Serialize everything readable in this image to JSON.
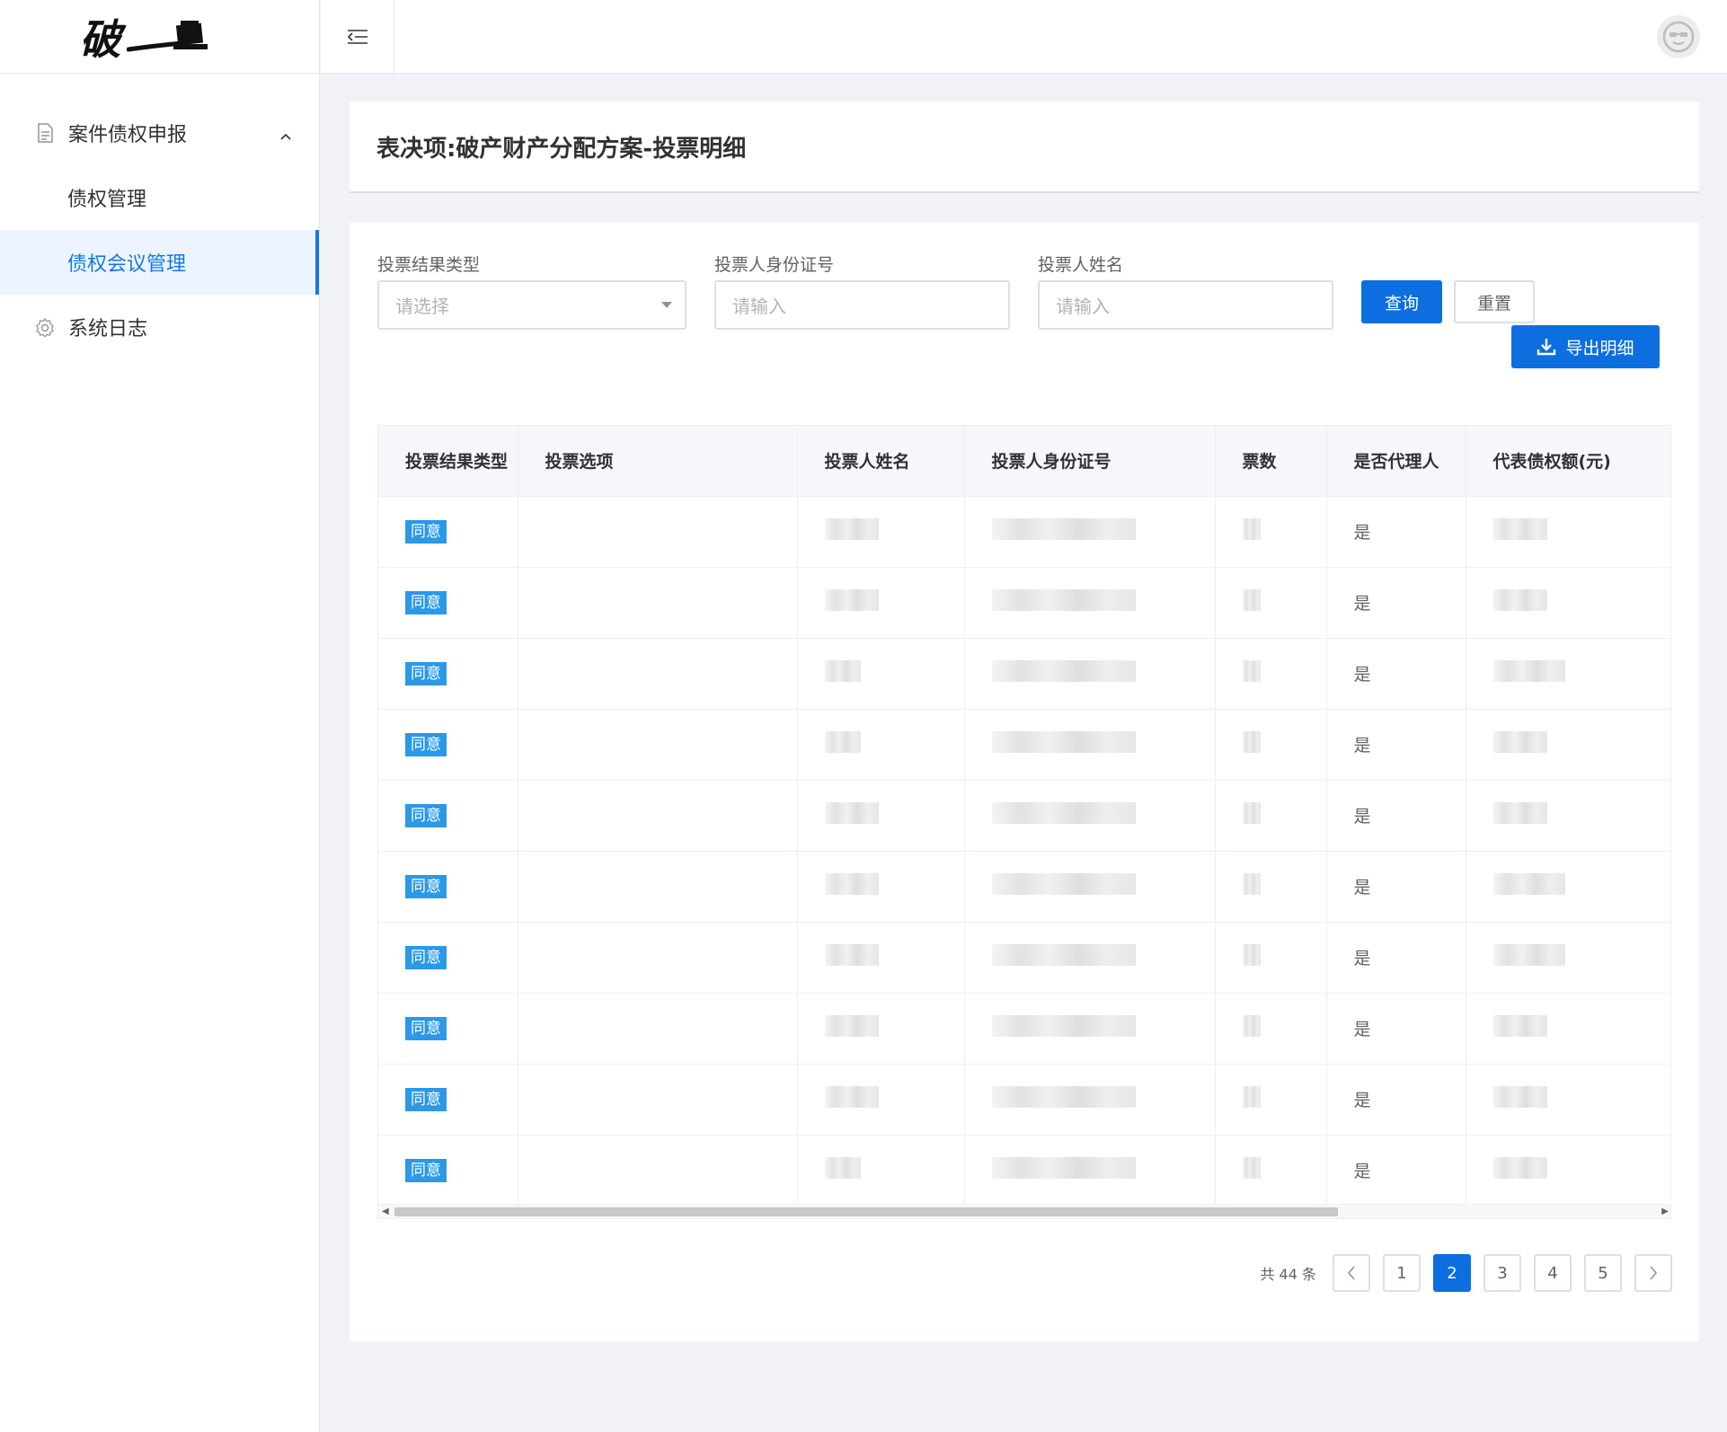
{
  "logo": {
    "text": "破"
  },
  "sidebar": {
    "group": {
      "label": "案件债权申报",
      "icon": "document-icon"
    },
    "items": [
      {
        "label": "债权管理"
      },
      {
        "label": "债权会议管理"
      }
    ],
    "log": {
      "label": "系统日志",
      "icon": "gear-icon"
    }
  },
  "page": {
    "title": "表决项:破产财产分配方案-投票明细"
  },
  "filters": {
    "vote_type": {
      "label": "投票结果类型",
      "placeholder": "请选择"
    },
    "id_number": {
      "label": "投票人身份证号",
      "placeholder": "请输入"
    },
    "name": {
      "label": "投票人姓名",
      "placeholder": "请输入"
    },
    "query_label": "查询",
    "reset_label": "重置",
    "export_label": "导出明细"
  },
  "table": {
    "columns": [
      "投票结果类型",
      "投票选项",
      "投票人姓名",
      "投票人身份证号",
      "票数",
      "是否代理人",
      "代表债权额(元)"
    ],
    "rows": [
      {
        "result": "同意",
        "proxy": "是"
      },
      {
        "result": "同意",
        "proxy": "是"
      },
      {
        "result": "同意",
        "proxy": "是"
      },
      {
        "result": "同意",
        "proxy": "是"
      },
      {
        "result": "同意",
        "proxy": "是"
      },
      {
        "result": "同意",
        "proxy": "是"
      },
      {
        "result": "同意",
        "proxy": "是"
      },
      {
        "result": "同意",
        "proxy": "是"
      },
      {
        "result": "同意",
        "proxy": "是"
      },
      {
        "result": "同意",
        "proxy": "是"
      }
    ]
  },
  "pagination": {
    "total_text": "共 44 条",
    "pages": [
      "1",
      "2",
      "3",
      "4",
      "5"
    ],
    "current": "2"
  },
  "colors": {
    "primary": "#0d6fdf",
    "tag": "#2b98e8",
    "active_bg": "#ecf5ff"
  }
}
